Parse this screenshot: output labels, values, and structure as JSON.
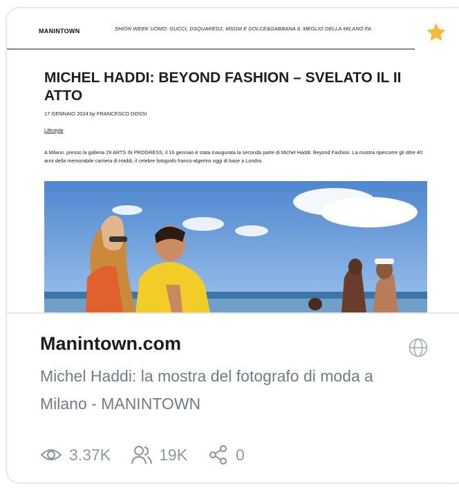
{
  "preview": {
    "site_logo": "MANINTOWN",
    "ticker": "SHION WEEK UOMO: GUCCI, DSQUARED2, MSGM E DOLCE&GABBANA   IL MEGLIO DELLA MILANO FA",
    "article_title": "MICHEL HADDI: BEYOND FASHION – SVELATO IL II ATTO",
    "article_meta": "17 GENNAIO 2024 by FRANCESCO DOSSI",
    "article_category": "Lifestyle",
    "article_body": "A Milano, presso la galleria 29 ARTS IN PROGRESS, il 16 gennaio è stata inaugurata la seconda parte di Michel Haddi: Beyond Fashion. La mostra ripercorre gli oltre 40 anni della memorabile carriera di Haddi, il celebre fotografo franco-algerino oggi di base a Londra."
  },
  "card": {
    "domain": "Manintown.com",
    "description": "Michel Haddi: la mostra del fotografo di moda a Milano - MANINTOWN"
  },
  "stats": {
    "views": "3.37K",
    "users": "19K",
    "shares": "0"
  },
  "colors": {
    "star": "#f6b93b",
    "muted": "#8f99a3",
    "description": "#6f7c89",
    "sky": "#5b8fd4",
    "sea": "#3c76a8"
  },
  "icons": [
    "star-icon",
    "globe-icon",
    "eye-icon",
    "users-icon",
    "share-icon"
  ]
}
